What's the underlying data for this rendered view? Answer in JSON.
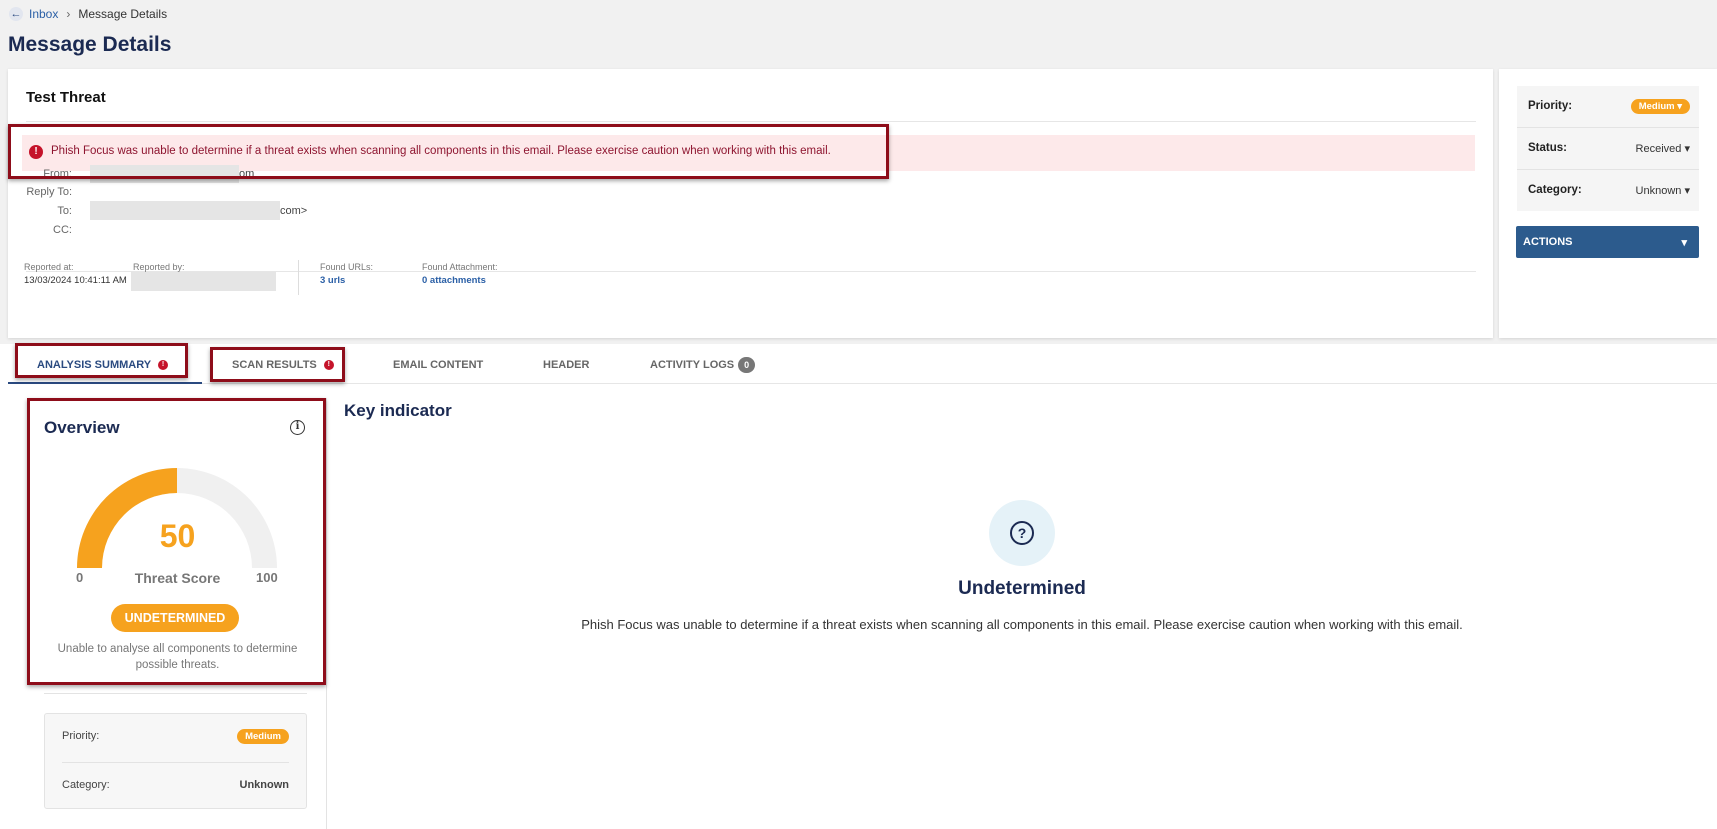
{
  "breadcrumb": {
    "back_icon": "arrow-left-icon",
    "inbox": "Inbox",
    "separator": "›",
    "current": "Message Details"
  },
  "page_title": "Message Details",
  "message": {
    "title": "Test Threat",
    "alert": "Phish Focus was unable to determine if a threat exists when scanning all components in this email. Please exercise caution when working with this email.",
    "from_label": "From:",
    "from_tail": "om",
    "reply_to_label": "Reply To:",
    "to_label": "To:",
    "to_tail": "com>",
    "cc_label": "CC:",
    "reported_at_label": "Reported at:",
    "reported_at_value": "13/03/2024 10:41:11 AM",
    "reported_by_label": "Reported by:",
    "found_urls_label": "Found URLs:",
    "found_urls_value": "3 urls",
    "found_attachment_label": "Found Attachment:",
    "found_attachment_value": "0 attachments"
  },
  "sidebar": {
    "priority_label": "Priority:",
    "priority_value": "Medium",
    "status_label": "Status:",
    "status_value": "Received",
    "category_label": "Category:",
    "category_value": "Unknown",
    "actions_label": "ACTIONS"
  },
  "tabs": [
    {
      "label": "ANALYSIS SUMMARY",
      "badge": "!"
    },
    {
      "label": "SCAN RESULTS",
      "badge": "!"
    },
    {
      "label": "EMAIL CONTENT"
    },
    {
      "label": "HEADER"
    },
    {
      "label": "ACTIVITY LOGS",
      "badge": "0"
    }
  ],
  "overview": {
    "title": "Overview",
    "info_icon": "i",
    "score": "50",
    "score_fraction": 0.5,
    "score_label": "Threat Score",
    "min": "0",
    "max": "100",
    "status": "UNDETERMINED",
    "description": "Unable to analyse all components to determine possible threats.",
    "priority_label": "Priority:",
    "priority_value": "Medium",
    "category_label": "Category:",
    "category_value": "Unknown"
  },
  "key_indicator": {
    "title": "Key indicator",
    "icon": "question-circle-icon",
    "status": "Undetermined",
    "description": "Phish Focus was unable to determine if a threat exists when scanning all components in this email. Please exercise caution when working with this email."
  },
  "colors": {
    "accent": "#f6a21e",
    "primary": "#2c5b8d",
    "title": "#1b2a52",
    "danger": "#c5132a",
    "highlight_border": "#8e0d1a"
  }
}
